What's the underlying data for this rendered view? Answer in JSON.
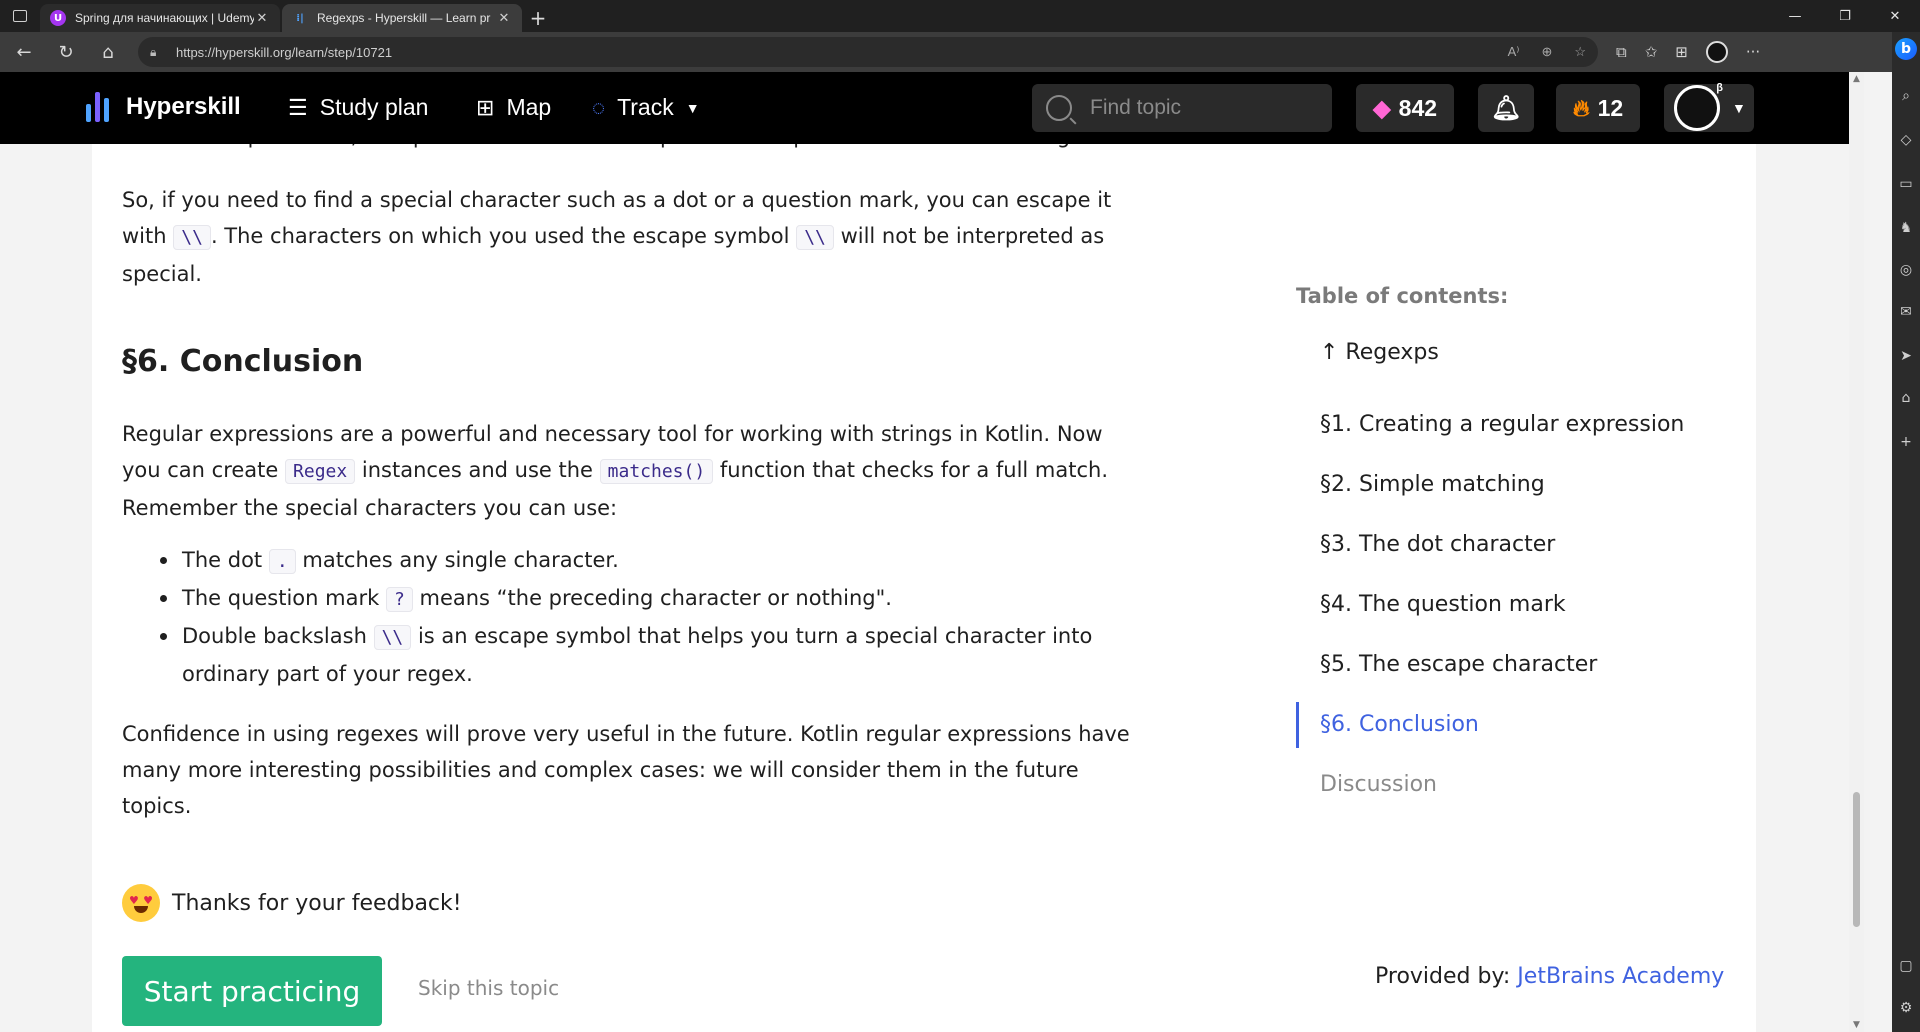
{
  "browser": {
    "tabs": [
      {
        "title": "Spring для начинающих | Udemy",
        "active": false,
        "favicon_color": "#a435f0",
        "favicon_letter": "U"
      },
      {
        "title": "Regexps - Hyperskill — Learn pr",
        "active": true,
        "favicon_color": "#2c2c2c",
        "favicon_letter": "|"
      }
    ],
    "url": "https://hyperskill.org/learn/step/10721"
  },
  "header": {
    "logo": "Hyperskill",
    "nav": {
      "study_plan": "Study plan",
      "map": "Map",
      "track": "Track"
    },
    "search_placeholder": "Find topic",
    "gems": "842",
    "streak": "12",
    "beta_badge": "β"
  },
  "article": {
    "clipped_line": "In the example above, the question mark was interpreted as a question mark and nothing more.",
    "p_escape_1": "So, if you need to find a special character such as a dot or a question mark, you can escape it",
    "p_escape_2a": "with",
    "p_escape_code1": "\\\\",
    "p_escape_2b": ". The characters on which you used the escape symbol",
    "p_escape_code2": "\\\\",
    "p_escape_2c": "will not be interpreted as",
    "p_escape_3": "special.",
    "conclusion_heading": "§6. Conclusion",
    "p_concl_1": "Regular expressions are a powerful and necessary tool for working with strings in Kotlin. Now",
    "p_concl_2a": "you can create",
    "p_concl_code1": "Regex",
    "p_concl_2b": "instances and use the",
    "p_concl_code2": "matches()",
    "p_concl_2c": "function that checks for a full match.",
    "p_concl_3": "Remember the special characters you can use:",
    "bullets": [
      {
        "pre": "The dot",
        "code": ".",
        "post": "matches any single character."
      },
      {
        "pre": "The question mark",
        "code": "?",
        "post": "means “the preceding character or nothing\"."
      },
      {
        "pre": "Double backslash",
        "code": "\\\\",
        "post": "is an escape symbol that helps you turn a special character into",
        "post2": "ordinary part of your regex."
      }
    ],
    "p_final_1": "Confidence in using regexes will prove very useful in the future. Kotlin regular expressions have",
    "p_final_2": "many more interesting possibilities and complex cases: we will consider them in the future",
    "p_final_3": "topics.",
    "feedback": "Thanks for your feedback!",
    "start_button": "Start practicing",
    "skip_link": "Skip this topic",
    "provided_by": "Provided by:",
    "provider": "JetBrains Academy"
  },
  "toc": {
    "title": "Table of contents:",
    "top_link": "↑ Regexps",
    "items": [
      {
        "label": "§1. Creating a regular expression",
        "state": "normal"
      },
      {
        "label": "§2. Simple matching",
        "state": "normal"
      },
      {
        "label": "§3. The dot character",
        "state": "normal"
      },
      {
        "label": "§4. The question mark",
        "state": "normal"
      },
      {
        "label": "§5. The escape character",
        "state": "normal"
      },
      {
        "label": "§6. Conclusion",
        "state": "active"
      },
      {
        "label": "Discussion",
        "state": "muted"
      }
    ]
  },
  "colors": {
    "accent": "#3f62e0",
    "primary_button": "#24b47e",
    "header_bg": "#000000"
  }
}
